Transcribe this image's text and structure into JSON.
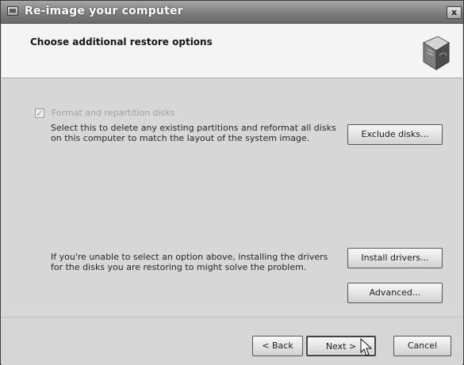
{
  "window": {
    "title": "Re-image your computer",
    "close_label": "x"
  },
  "header": {
    "title": "Choose additional restore options"
  },
  "options": {
    "format_checkbox": {
      "label": "Format and repartition disks",
      "checked": true,
      "mark": "✓"
    },
    "format_description_line1": "Select this to delete any existing partitions and reformat all disks",
    "format_description_line2": "on this computer to match the layout of the system image.",
    "exclude_button": "Exclude disks...",
    "driver_description_line1": "If you're unable to select an option above, installing the drivers",
    "driver_description_line2": "for the disks you are restoring to might solve the problem.",
    "install_button": "Install drivers...",
    "advanced_button": "Advanced..."
  },
  "footer": {
    "back": "< Back",
    "next": "Next >",
    "cancel": "Cancel"
  },
  "icons": {
    "title_icon": "window-icon",
    "header_icon": "restore-drive-icon",
    "cursor_icon": "mouse-pointer-icon"
  },
  "colors": {
    "title_bar": "#808080",
    "dialog_background": "#dcdcdc",
    "disabled_text": "#a1a1a1"
  }
}
